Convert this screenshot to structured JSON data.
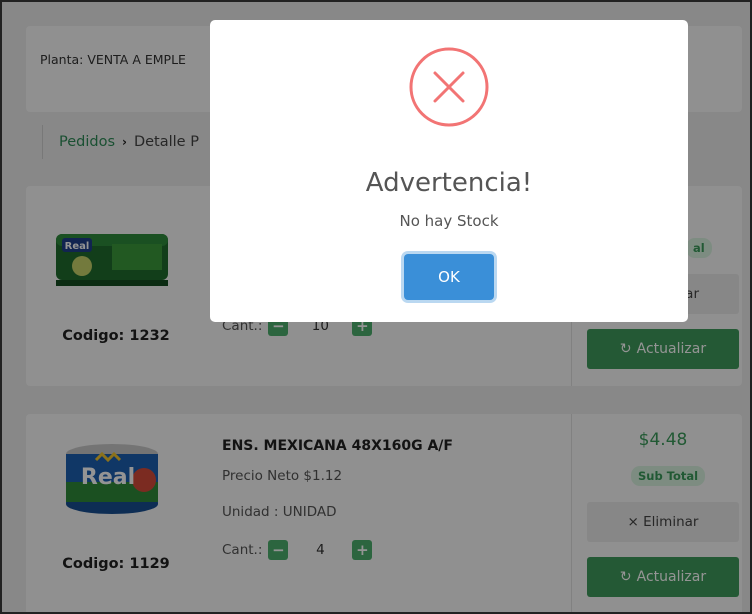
{
  "plant": {
    "label": "Planta: VENTA A EMPLE"
  },
  "breadcrumb": {
    "link": "Pedidos",
    "separator": "›",
    "current": "Detalle P"
  },
  "products": [
    {
      "brand": "Real",
      "name": "",
      "price": "",
      "unit": "",
      "code": "Codigo: 1232",
      "qty_label": "Cant.:",
      "qty": "10",
      "total": "",
      "subtotal_label": "al",
      "eliminar_label": "ar",
      "actualizar_label": "Actualizar"
    },
    {
      "brand": "Real",
      "name": "ENS. MEXICANA 48X160G A/F",
      "price": "Precio Neto $1.12",
      "unit": "Unidad : UNIDAD",
      "code": "Codigo: 1129",
      "qty_label": "Cant.:",
      "qty": "4",
      "total": "$4.48",
      "subtotal_label": "Sub Total",
      "eliminar_label": "× Eliminar",
      "actualizar_label": "Actualizar"
    }
  ],
  "modal": {
    "icon": "error-x-icon",
    "title": "Advertencia!",
    "text": "No hay Stock",
    "ok_label": "OK"
  },
  "colors": {
    "accent_green": "#3f9a5c",
    "error_red": "#f27474",
    "ok_blue": "#3a8fd8"
  }
}
